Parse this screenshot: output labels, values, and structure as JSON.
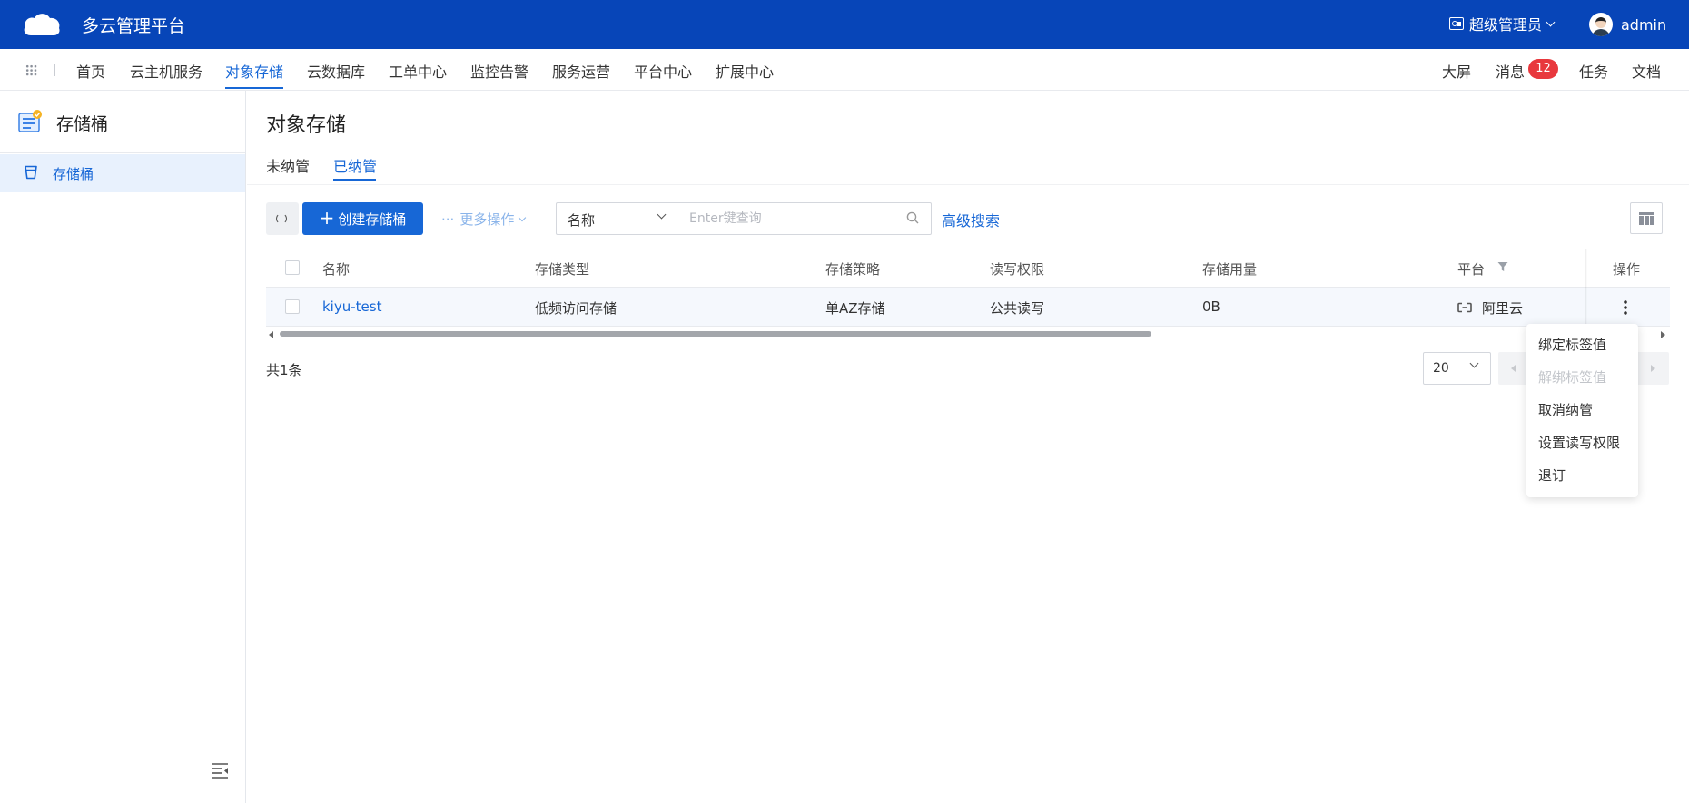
{
  "topbar": {
    "app_title": "多云管理平台",
    "role": "超级管理员",
    "username": "admin",
    "bg_color": "#0745b8"
  },
  "nav": {
    "items": [
      "首页",
      "云主机服务",
      "对象存储",
      "云数据库",
      "工单中心",
      "监控告警",
      "服务运营",
      "平台中心",
      "扩展中心"
    ],
    "active_index": 2,
    "right": {
      "bigscreen": "大屏",
      "messages": "消息",
      "message_count": "12",
      "tasks": "任务",
      "docs": "文档"
    }
  },
  "sidebar": {
    "title": "存储桶",
    "items": [
      {
        "label": "存储桶",
        "active": true
      }
    ]
  },
  "main": {
    "page_title": "对象存储",
    "tabs": [
      "未纳管",
      "已纳管"
    ],
    "active_tab": 1,
    "toolbar": {
      "create_label": "创建存储桶",
      "more_label": "更多操作",
      "field_select": "名称",
      "search_placeholder": "Enter键查询",
      "advanced_search": "高级搜索"
    },
    "table": {
      "columns": [
        "名称",
        "存储类型",
        "存储策略",
        "读写权限",
        "存储用量",
        "平台",
        "操作"
      ],
      "rows": [
        {
          "name": "kiyu-test",
          "storage_type": "低频访问存储",
          "strategy": "单AZ存储",
          "permission": "公共读写",
          "usage": "0B",
          "platform": "阿里云"
        }
      ]
    },
    "pagination": {
      "total": "共1条",
      "page_size": "20"
    },
    "row_menu": [
      {
        "label": "绑定标签值",
        "disabled": false
      },
      {
        "label": "解绑标签值",
        "disabled": true
      },
      {
        "label": "取消纳管",
        "disabled": false
      },
      {
        "label": "设置读写权限",
        "disabled": false
      },
      {
        "label": "退订",
        "disabled": false
      }
    ]
  },
  "colors": {
    "primary": "#1767d6",
    "badge": "#e8383d",
    "sidebar_active_bg": "#e8f1fd"
  }
}
